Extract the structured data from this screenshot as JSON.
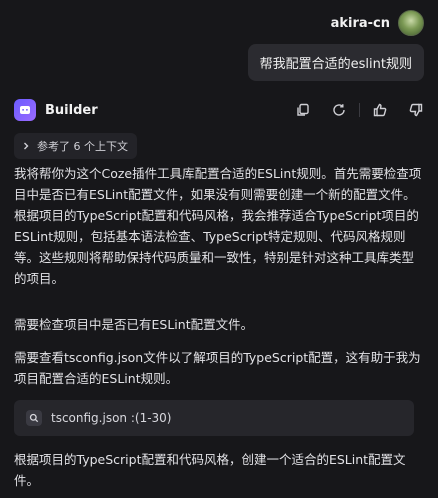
{
  "user": {
    "name": "akira-cn",
    "message": "帮我配置合适的eslint规则"
  },
  "bot": {
    "name": "Builder",
    "context_label": "参考了 6 个上下文",
    "paragraphs": [
      "我将帮你为这个Coze插件工具库配置合适的ESLint规则。首先需要检查项目中是否已有ESLint配置文件，如果没有则需要创建一个新的配置文件。根据项目的TypeScript配置和代码风格，我会推荐适合TypeScript项目的ESLint规则，包括基本语法检查、TypeScript特定规则、代码风格规则等。这些规则将帮助保持代码质量和一致性，特别是针对这种工具库类型的项目。",
      "需要检查项目中是否已有ESLint配置文件。",
      "需要查看tsconfig.json文件以了解项目的TypeScript配置，这有助于我为项目配置合适的ESLint规则。"
    ],
    "tool_call": "tsconfig.json :(1-30)",
    "paragraph_after": "根据项目的TypeScript配置和代码风格，创建一个适合的ESLint配置文件。"
  },
  "icons": {
    "copy": "copy-icon",
    "regenerate": "refresh-icon",
    "like": "thumbs-up-icon",
    "dislike": "thumbs-down-icon",
    "expand": "chevron-right-icon",
    "search": "search-icon",
    "bot": "bot-icon"
  }
}
